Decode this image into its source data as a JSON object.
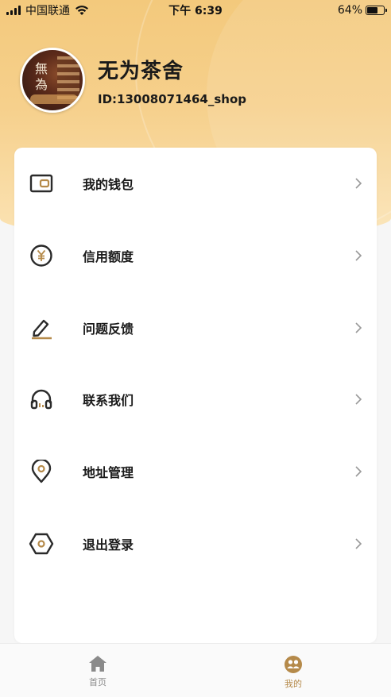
{
  "status_bar": {
    "carrier": "中国联通",
    "time": "下午 6:39",
    "battery": "64%",
    "battery_level": 0.64
  },
  "profile": {
    "shop_name": "无为茶舍",
    "shop_id": "ID:13008071464_shop",
    "avatar_text": "無為"
  },
  "menu": {
    "items": [
      {
        "label": "我的钱包",
        "icon": "wallet-icon"
      },
      {
        "label": "信用额度",
        "icon": "yuan-icon"
      },
      {
        "label": "问题反馈",
        "icon": "edit-icon"
      },
      {
        "label": "联系我们",
        "icon": "headset-icon"
      },
      {
        "label": "地址管理",
        "icon": "location-icon"
      },
      {
        "label": "退出登录",
        "icon": "logout-icon"
      }
    ]
  },
  "tabbar": {
    "tabs": [
      {
        "label": "首页",
        "icon": "home-icon",
        "active": false
      },
      {
        "label": "我的",
        "icon": "mine-icon",
        "active": true
      }
    ]
  },
  "colors": {
    "accent": "#b58a4a",
    "hero_gradient_start": "#f3c97c",
    "hero_gradient_end": "#fbe3b4",
    "icon_dark": "#2a2a2a",
    "icon_accent": "#b58a4a",
    "inactive": "#8a8a8a"
  }
}
